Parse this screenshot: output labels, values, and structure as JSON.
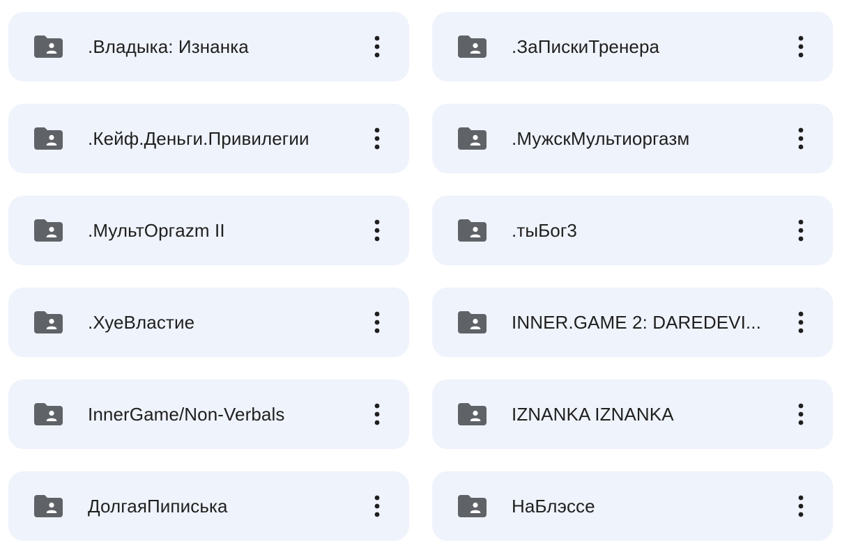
{
  "folders": [
    {
      "name": ".Владыка: Изнанка",
      "icon": "shared-folder-icon"
    },
    {
      "name": ".ЗаПискиТренера",
      "icon": "shared-folder-icon"
    },
    {
      "name": ".Кейф.Деньги.Привилегии",
      "icon": "shared-folder-icon"
    },
    {
      "name": ".МужскМультиоргазм",
      "icon": "shared-folder-icon"
    },
    {
      "name": ".МультOргazm II",
      "icon": "shared-folder-icon"
    },
    {
      "name": ".тыБог3",
      "icon": "shared-folder-icon"
    },
    {
      "name": ".ХуеВластие",
      "icon": "shared-folder-icon"
    },
    {
      "name": "INNER.GAME 2: DAREDEVI...",
      "icon": "shared-folder-icon"
    },
    {
      "name": "InnerGame/Non-Verbals",
      "icon": "shared-folder-icon"
    },
    {
      "name": "IZNANKA IZNANKA",
      "icon": "shared-folder-icon"
    },
    {
      "name": "ДолгаяПиписька",
      "icon": "shared-folder-icon"
    },
    {
      "name": "НаБлэссе",
      "icon": "shared-folder-icon"
    }
  ],
  "more_button_icon": "more-vert-icon",
  "colors": {
    "card_background": "#eff3fb",
    "icon": "#5f6368",
    "text": "#1f1f1f"
  }
}
